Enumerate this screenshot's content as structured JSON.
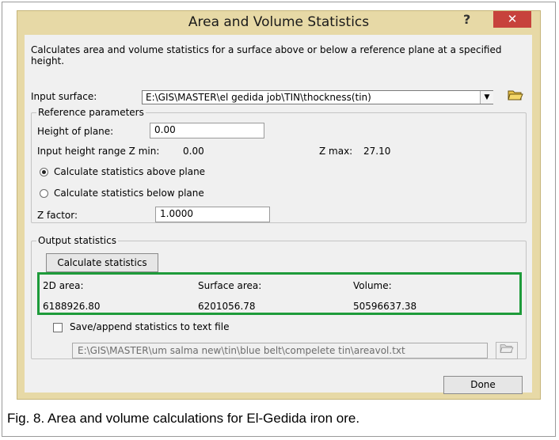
{
  "dialog": {
    "title": "Area and Volume Statistics",
    "help_label": "?",
    "close_label": "✕",
    "description": "Calculates area and volume statistics for a surface above or below a reference plane at a specified height.",
    "input_surface_label": "Input surface:",
    "input_surface_value": "E:\\GIS\\MASTER\\el gedida job\\TIN\\thockness(tin)",
    "folder_icon": "folder-open-icon",
    "reference": {
      "legend": "Reference parameters",
      "height_label": "Height of plane:",
      "height_value": "0.00",
      "range_label": "Input height range  Z min:",
      "zmin_value": "0.00",
      "zmax_label": "Z max:",
      "zmax_value": "27.10",
      "above_label": "Calculate statistics above plane",
      "below_label": "Calculate statistics below plane",
      "above_selected": true,
      "zfactor_label": "Z factor:",
      "zfactor_value": "1.0000"
    },
    "output": {
      "legend": "Output statistics",
      "calc_button": "Calculate statistics",
      "area2d_label": "2D area:",
      "surface_label": "Surface area:",
      "volume_label": "Volume:",
      "area2d_value": "6188926.80",
      "surface_value": "6201056.78",
      "volume_value": "50596637.38",
      "highlight_color": "#1e9b3a"
    },
    "save": {
      "label": "Save/append statistics to text file",
      "checked": false,
      "path": "E:\\GIS\\MASTER\\um salma new\\tin\\blue belt\\compelete tin\\areavol.txt"
    },
    "done_button": "Done"
  },
  "caption": "Fig. 8. Area and volume calculations for El-Gedida iron ore."
}
